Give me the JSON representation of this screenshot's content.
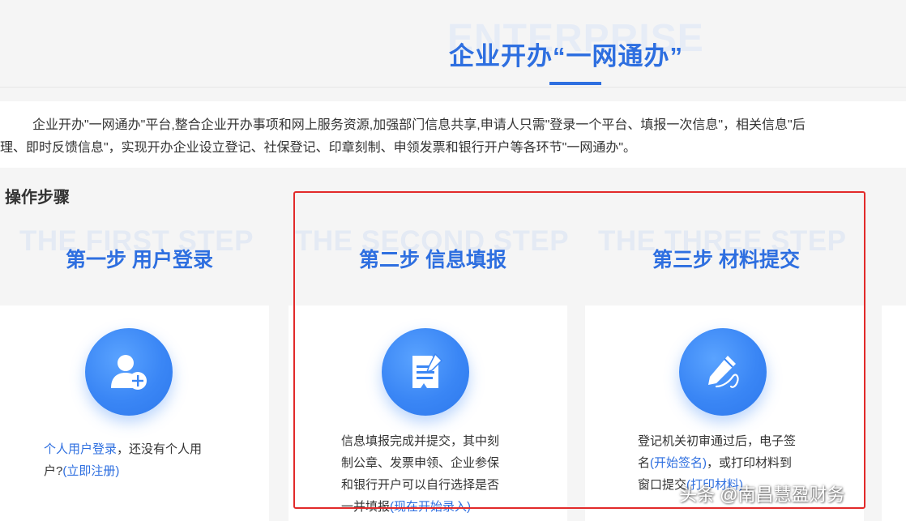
{
  "header": {
    "bg_word": "ENTERPRISE",
    "title": "企业开办“一网通办”"
  },
  "intro": {
    "line1": "企业开办\"一网通办\"平台,整合企业开办事项和网上服务资源,加强部门信息共享,申请人只需\"登录一个平台、填报一次信息\"，相关信息\"后",
    "line2": "理、即时反馈信息\"，实现开办企业设立登记、社保登记、印章刻制、申领发票和银行开户等各环节\"一网通办\"。"
  },
  "steps_title": "操作步骤",
  "steps": [
    {
      "bg": "THE FIRST STEP",
      "title": "第一步 用户登录",
      "icon": "user-add-icon"
    },
    {
      "bg": "THE SECOND STEP",
      "title": "第二步 信息填报",
      "icon": "document-edit-icon"
    },
    {
      "bg": "THE THREE STEP",
      "title": "第三步 材料提交",
      "icon": "pen-icon"
    }
  ],
  "cards": {
    "c1": {
      "link1": "个人用户登录",
      "text1": "，还没有个人用",
      "text2": "户?",
      "link2": "(立即注册)"
    },
    "c2": {
      "line1": "信息填报完成并提交，其中刻",
      "line2": "制公章、发票申领、企业参保",
      "line3": "和银行开户可以自行选择是否",
      "line4": "一并填报",
      "link": "(现在开始录入)"
    },
    "c3": {
      "line1": "登记机关初审通过后，电子签",
      "line2a": "名",
      "link1": "(开始签名)",
      "line2b": "，或打印材料到",
      "line3": "窗口提交",
      "link2": "(打印材料)"
    }
  },
  "watermark": "头条 @南昌慧盈财务",
  "colors": {
    "accent": "#2e6fe0",
    "highlight_box": "#e22a2a"
  }
}
